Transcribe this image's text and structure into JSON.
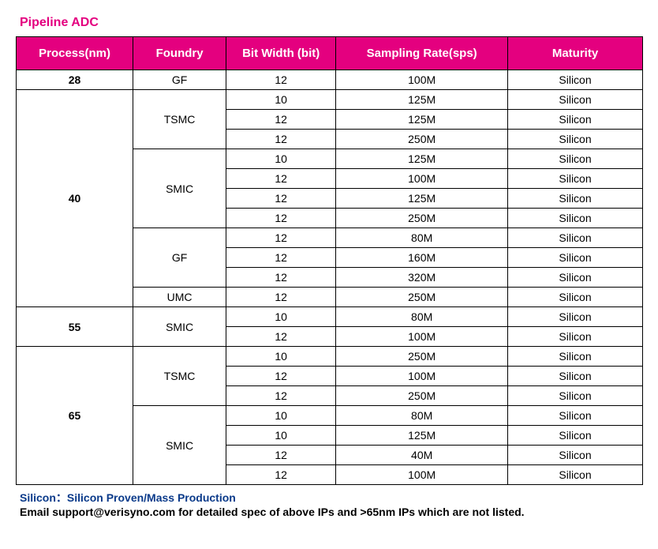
{
  "title": "Pipeline ADC",
  "headers": {
    "process": "Process(nm)",
    "foundry": "Foundry",
    "bitwidth": "Bit Width (bit)",
    "rate": "Sampling Rate(sps)",
    "maturity": "Maturity"
  },
  "chart_data": {
    "type": "table",
    "title": "Pipeline ADC",
    "columns": [
      "Process(nm)",
      "Foundry",
      "Bit Width (bit)",
      "Sampling Rate(sps)",
      "Maturity"
    ],
    "rows": [
      {
        "process": "28",
        "foundry": "GF",
        "bitwidth": "12",
        "rate": "100M",
        "maturity": "Silicon"
      },
      {
        "process": "40",
        "foundry": "TSMC",
        "bitwidth": "10",
        "rate": "125M",
        "maturity": "Silicon"
      },
      {
        "process": "40",
        "foundry": "TSMC",
        "bitwidth": "12",
        "rate": "125M",
        "maturity": "Silicon"
      },
      {
        "process": "40",
        "foundry": "TSMC",
        "bitwidth": "12",
        "rate": "250M",
        "maturity": "Silicon"
      },
      {
        "process": "40",
        "foundry": "SMIC",
        "bitwidth": "10",
        "rate": "125M",
        "maturity": "Silicon"
      },
      {
        "process": "40",
        "foundry": "SMIC",
        "bitwidth": "12",
        "rate": "100M",
        "maturity": "Silicon"
      },
      {
        "process": "40",
        "foundry": "SMIC",
        "bitwidth": "12",
        "rate": "125M",
        "maturity": "Silicon"
      },
      {
        "process": "40",
        "foundry": "SMIC",
        "bitwidth": "12",
        "rate": "250M",
        "maturity": "Silicon"
      },
      {
        "process": "40",
        "foundry": "GF",
        "bitwidth": "12",
        "rate": "80M",
        "maturity": "Silicon"
      },
      {
        "process": "40",
        "foundry": "GF",
        "bitwidth": "12",
        "rate": "160M",
        "maturity": "Silicon"
      },
      {
        "process": "40",
        "foundry": "GF",
        "bitwidth": "12",
        "rate": "320M",
        "maturity": "Silicon"
      },
      {
        "process": "40",
        "foundry": "UMC",
        "bitwidth": "12",
        "rate": "250M",
        "maturity": "Silicon"
      },
      {
        "process": "55",
        "foundry": "SMIC",
        "bitwidth": "10",
        "rate": "80M",
        "maturity": "Silicon"
      },
      {
        "process": "55",
        "foundry": "SMIC",
        "bitwidth": "12",
        "rate": "100M",
        "maturity": "Silicon"
      },
      {
        "process": "65",
        "foundry": "TSMC",
        "bitwidth": "10",
        "rate": "250M",
        "maturity": "Silicon"
      },
      {
        "process": "65",
        "foundry": "TSMC",
        "bitwidth": "12",
        "rate": "100M",
        "maturity": "Silicon"
      },
      {
        "process": "65",
        "foundry": "TSMC",
        "bitwidth": "12",
        "rate": "250M",
        "maturity": "Silicon"
      },
      {
        "process": "65",
        "foundry": "SMIC",
        "bitwidth": "10",
        "rate": "80M",
        "maturity": "Silicon"
      },
      {
        "process": "65",
        "foundry": "SMIC",
        "bitwidth": "10",
        "rate": "125M",
        "maturity": "Silicon"
      },
      {
        "process": "65",
        "foundry": "SMIC",
        "bitwidth": "12",
        "rate": "40M",
        "maturity": "Silicon"
      },
      {
        "process": "65",
        "foundry": "SMIC",
        "bitwidth": "12",
        "rate": "100M",
        "maturity": "Silicon"
      }
    ]
  },
  "footer": {
    "line1_key": "Silicon",
    "line1_sep": "：",
    "line1_val": "Silicon Proven/Mass Production",
    "line2": "Email support@verisyno.com for detailed spec of above IPs and >65nm IPs which are not listed."
  }
}
